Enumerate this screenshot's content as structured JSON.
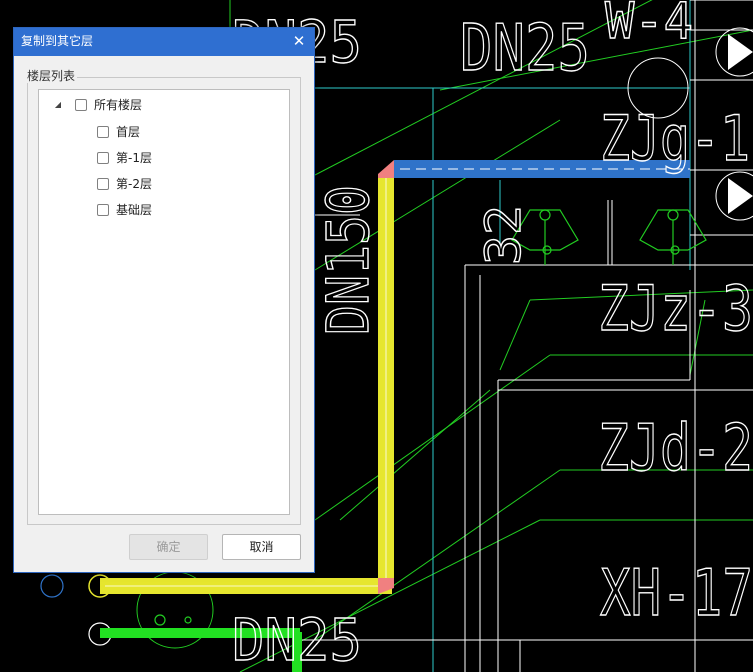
{
  "dialog": {
    "title": "复制到其它层",
    "close_icon": "close-icon",
    "group_label": "楼层列表",
    "tree": {
      "root": {
        "label": "所有楼层",
        "expanded": true,
        "checked": false
      },
      "children": [
        {
          "label": "首层",
          "checked": false
        },
        {
          "label": "第-1层",
          "checked": false
        },
        {
          "label": "第-2层",
          "checked": false
        },
        {
          "label": "基础层",
          "checked": false
        }
      ]
    },
    "ok_label": "确定",
    "ok_enabled": false,
    "cancel_label": "取消"
  },
  "drawing": {
    "labels": {
      "dn25_top_left": "DN25",
      "dn25_top_mid": "DN25",
      "w4": "W-4",
      "zjg1": "ZJg-1",
      "dn150": "DN150",
      "n32": "32",
      "zjz3": "ZJz-3",
      "zjd2": "ZJd-2",
      "xh17": "XH-17",
      "dn25_bottom": "DN25"
    },
    "colors": {
      "background": "#000000",
      "pipe_yellow": "#e6e62e",
      "pipe_selected_blue": "#2f73c9",
      "pipe_green": "#22e022",
      "line_green": "#22cc22",
      "line_cyan": "#2ecccc",
      "line_white": "#ffffff"
    }
  }
}
